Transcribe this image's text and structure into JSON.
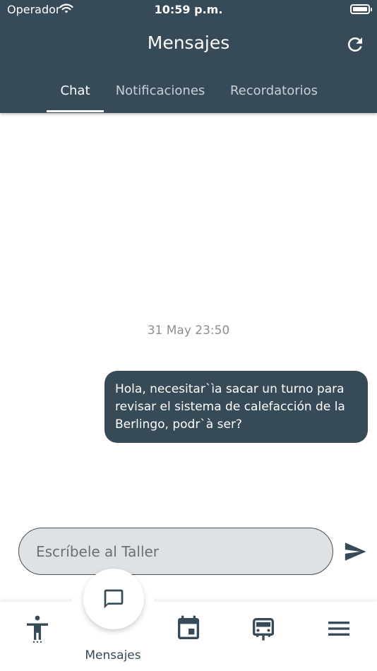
{
  "status_bar": {
    "carrier": "Operador",
    "time": "10:59 p.m."
  },
  "header": {
    "title": "Mensajes",
    "refresh_icon": "refresh-icon",
    "background_color": "#374a57"
  },
  "tabs": [
    {
      "label": "Chat",
      "active": true
    },
    {
      "label": "Notificaciones",
      "active": false
    },
    {
      "label": "Recordatorios",
      "active": false
    }
  ],
  "chat": {
    "date_separator": "31 May 23:50",
    "messages": [
      {
        "direction": "outgoing",
        "text": "Hola, necesitar`ìa sacar un turno para revisar el sistema de calefacción de la Berlingo, podr`à ser?"
      }
    ]
  },
  "composer": {
    "placeholder": "Escríbele al Taller",
    "value": "",
    "send_icon": "send-icon"
  },
  "bottom_nav": {
    "items": [
      {
        "icon": "accessibility-icon"
      },
      {
        "icon": "chat-bubble-icon",
        "label": "Mensajes",
        "active": true
      },
      {
        "icon": "calendar-icon"
      },
      {
        "icon": "car-icon"
      },
      {
        "icon": "menu-icon"
      }
    ]
  }
}
